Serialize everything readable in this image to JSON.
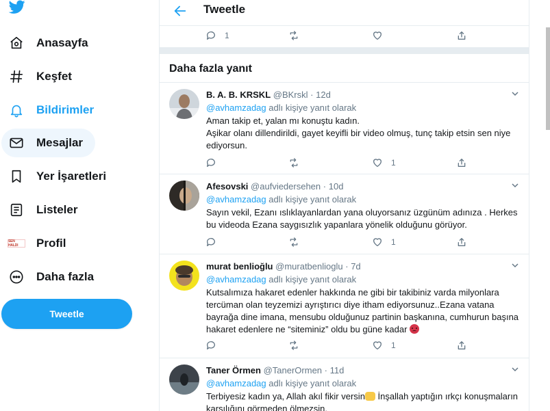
{
  "nav": {
    "items": [
      {
        "label": "Anasayfa",
        "icon": "home-icon"
      },
      {
        "label": "Keşfet",
        "icon": "hashtag-icon"
      },
      {
        "label": "Bildirimler",
        "icon": "bell-icon"
      },
      {
        "label": "Mesajlar",
        "icon": "mail-icon"
      },
      {
        "label": "Yer İşaretleri",
        "icon": "bookmark-icon"
      },
      {
        "label": "Listeler",
        "icon": "list-icon"
      },
      {
        "label": "Profil",
        "icon": "profile-avatar"
      },
      {
        "label": "Daha fazla",
        "icon": "more-icon"
      }
    ],
    "tweet_button": "Tweetle",
    "profile_badge_text": "SEN HALDI"
  },
  "header": {
    "title": "Tweetle"
  },
  "top_actions": {
    "reply_count": "1"
  },
  "section_title": "Daha fazla yanıt",
  "tweets": [
    {
      "name": "B. A. B. KRSKL",
      "handle": "@BKrskl",
      "dot": "·",
      "date": "12d",
      "reply_mention": "@avhamzadag",
      "reply_suffix": " adlı kişiye yanıt olarak",
      "line1": "Aman takip et, yalan mı konuştu kadın.",
      "line2": "Aşikar olanı dillendirildi, gayet keyifli bir video olmuş, tunç takip etsin sen niye ediyorsun.",
      "like_count": "1"
    },
    {
      "name": "Afesovski",
      "handle": "@aufviedersehen",
      "dot": "·",
      "date": "10d",
      "reply_mention": "@avhamzadag",
      "reply_suffix": " adlı kişiye yanıt olarak",
      "line1": "Sayın vekil, Ezanı ıslıklayanlardan yana oluyorsanız üzgünüm adınıza . Herkes bu videoda Ezana saygısızlık yapanlara yönelik olduğunu görüyor.",
      "like_count": "1"
    },
    {
      "name": "murat benlioğlu",
      "handle": "@muratbenlioglu",
      "dot": "·",
      "date": "7d",
      "reply_mention": "@avhamzadag",
      "reply_suffix": " adlı kişiye yanıt olarak",
      "line1": "Kutsalımıza hakaret edenler hakkında ne gibi bir takibiniz varda milyonlara tercüman olan teyzemizi ayrıştırıcı diye itham ediyorsunuz..Ezana vatana bayrağa dine imana, mensubu olduğunuz partinin başkanına, cumhurun başına hakaret edenlere ne “siteminiz” oldu bu güne kadar",
      "emoji": "angry-face-emoji",
      "like_count": "1"
    },
    {
      "name": "Taner Örmen",
      "handle": "@TanerOrmen",
      "dot": "·",
      "date": "11d",
      "reply_mention": "@avhamzadag",
      "reply_suffix": " adlı kişiye yanıt olarak",
      "line1a": "Terbiyesiz kadın ya, Allah akıl fikir versin",
      "line1b": " İnşallah yaptığın ırkçı konuşmaların karşılığını görmeden ölmezsin.",
      "emoji": "folded-hands-emoji"
    }
  ],
  "colors": {
    "accent": "#1da1f2",
    "text": "#14171a",
    "muted": "#657786",
    "border": "#e6ecf0"
  }
}
